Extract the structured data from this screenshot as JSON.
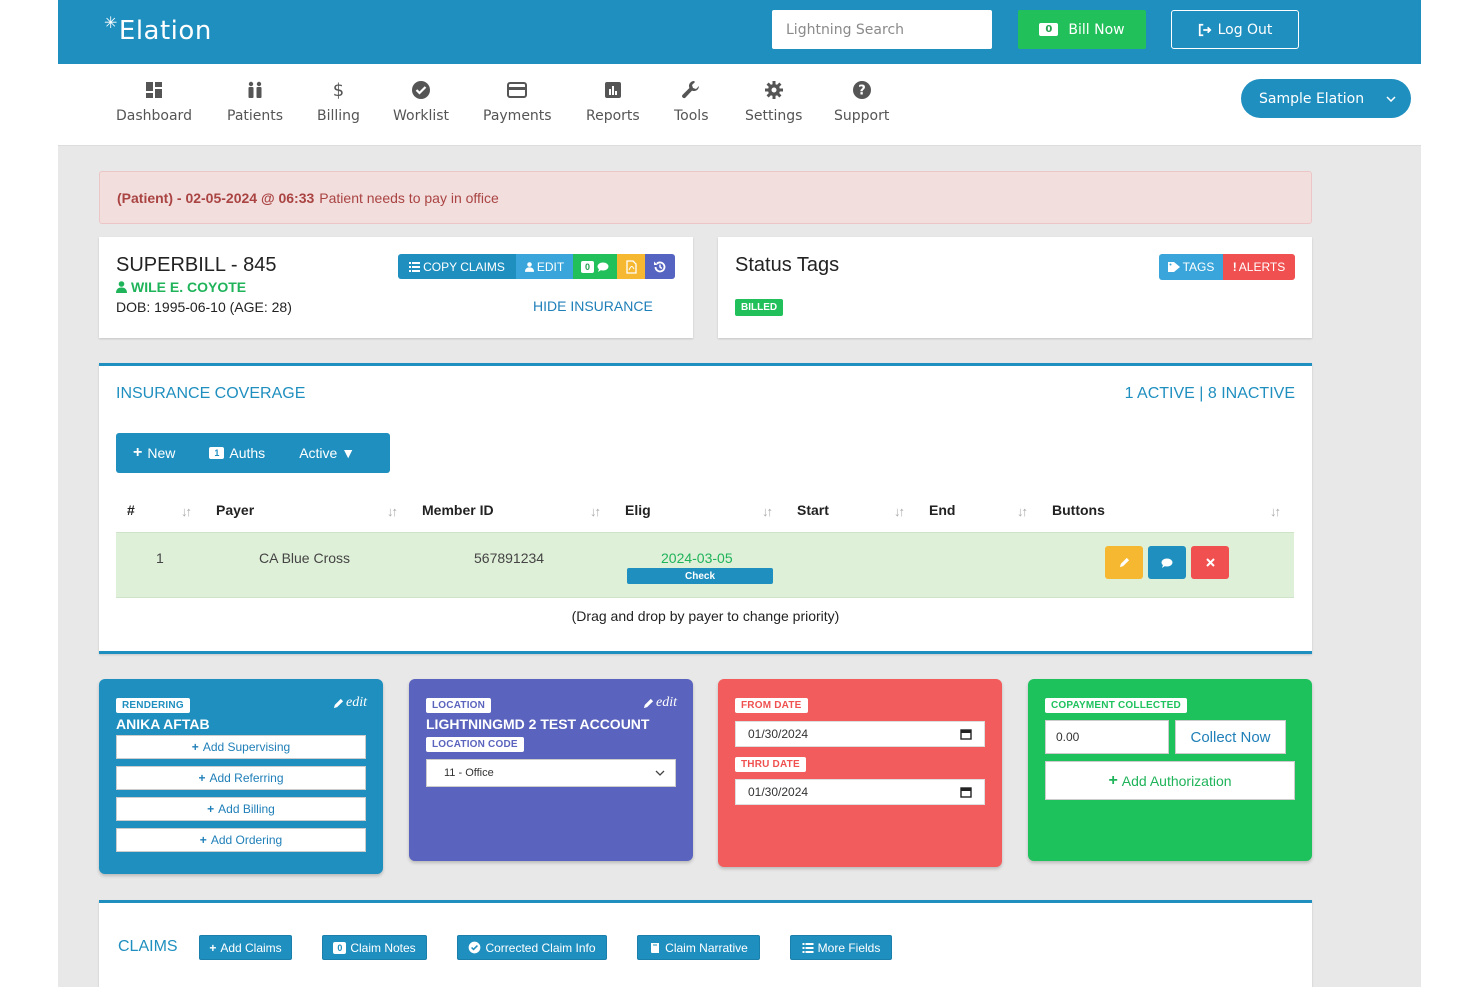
{
  "header": {
    "brand": "Elation",
    "search_placeholder": "Lightning Search",
    "bill_now_label": "Bill Now",
    "bill_now_count": "0",
    "logout_label": "Log Out"
  },
  "nav": {
    "items": [
      {
        "label": "Dashboard",
        "icon": "dashboard-icon"
      },
      {
        "label": "Patients",
        "icon": "patients-icon"
      },
      {
        "label": "Billing",
        "icon": "dollar-icon"
      },
      {
        "label": "Worklist",
        "icon": "check-circle-icon"
      },
      {
        "label": "Payments",
        "icon": "credit-card-icon"
      },
      {
        "label": "Reports",
        "icon": "bar-chart-icon"
      },
      {
        "label": "Tools",
        "icon": "wrench-icon"
      },
      {
        "label": "Settings",
        "icon": "gear-icon"
      },
      {
        "label": "Support",
        "icon": "question-icon"
      }
    ],
    "user_menu_label": "Sample Elation"
  },
  "alert": {
    "prefix": "(Patient) - 02-05-2024 @ 06:33",
    "message": "Patient needs to pay in office"
  },
  "superbill": {
    "title": "SUPERBILL - 845",
    "patient_name": "WILE E. COYOTE",
    "dob": "DOB: 1995-06-10 (AGE: 28)",
    "copy_claims_label": "COPY CLAIMS",
    "edit_label": "EDIT",
    "comment_count": "0",
    "hide_insurance_label": "HIDE INSURANCE"
  },
  "status_tags": {
    "title": "Status Tags",
    "tags_label": "TAGS",
    "alerts_label": "ALERTS",
    "badge": "BILLED"
  },
  "insurance": {
    "title": "INSURANCE COVERAGE",
    "summary": "1 ACTIVE | 8 INACTIVE",
    "new_label": "New",
    "auths_count": "1",
    "auths_label": "Auths",
    "active_filter": "Active ▼",
    "columns": [
      "#",
      "Payer",
      "Member ID",
      "Elig",
      "Start",
      "End",
      "Buttons"
    ],
    "rows": [
      {
        "num": "1",
        "payer": "CA Blue Cross",
        "member_id": "567891234",
        "elig": "2024-03-05",
        "check_label": "Check",
        "start": "",
        "end": ""
      }
    ],
    "drag_note": "(Drag and drop by payer to change priority)"
  },
  "rendering": {
    "label": "RENDERING",
    "value": "ANIKA AFTAB",
    "edit_label": "edit",
    "buttons": [
      "Add Supervising",
      "Add Referring",
      "Add Billing",
      "Add Ordering"
    ]
  },
  "location": {
    "label": "LOCATION",
    "value": "LIGHTNINGMD 2 TEST ACCOUNT",
    "edit_label": "edit",
    "code_label": "LOCATION CODE",
    "code_value": "11 - Office"
  },
  "dates": {
    "from_label": "FROM DATE",
    "from_value": "01/30/2024",
    "thru_label": "THRU DATE",
    "thru_value": "01/30/2024"
  },
  "copay": {
    "label": "COPAYMENT COLLECTED",
    "value": "0.00",
    "collect_label": "Collect Now",
    "add_auth_label": "Add Authorization"
  },
  "claims": {
    "title": "CLAIMS",
    "add_claims_label": "Add Claims",
    "notes_count": "0",
    "notes_label": "Claim Notes",
    "corrected_label": "Corrected Claim Info",
    "narrative_label": "Claim Narrative",
    "more_fields_label": "More Fields"
  },
  "colors": {
    "primary": "#1f8fbf",
    "success": "#22c05a",
    "danger": "#f05050",
    "warning": "#f5b830",
    "indigo": "#5563c1"
  }
}
